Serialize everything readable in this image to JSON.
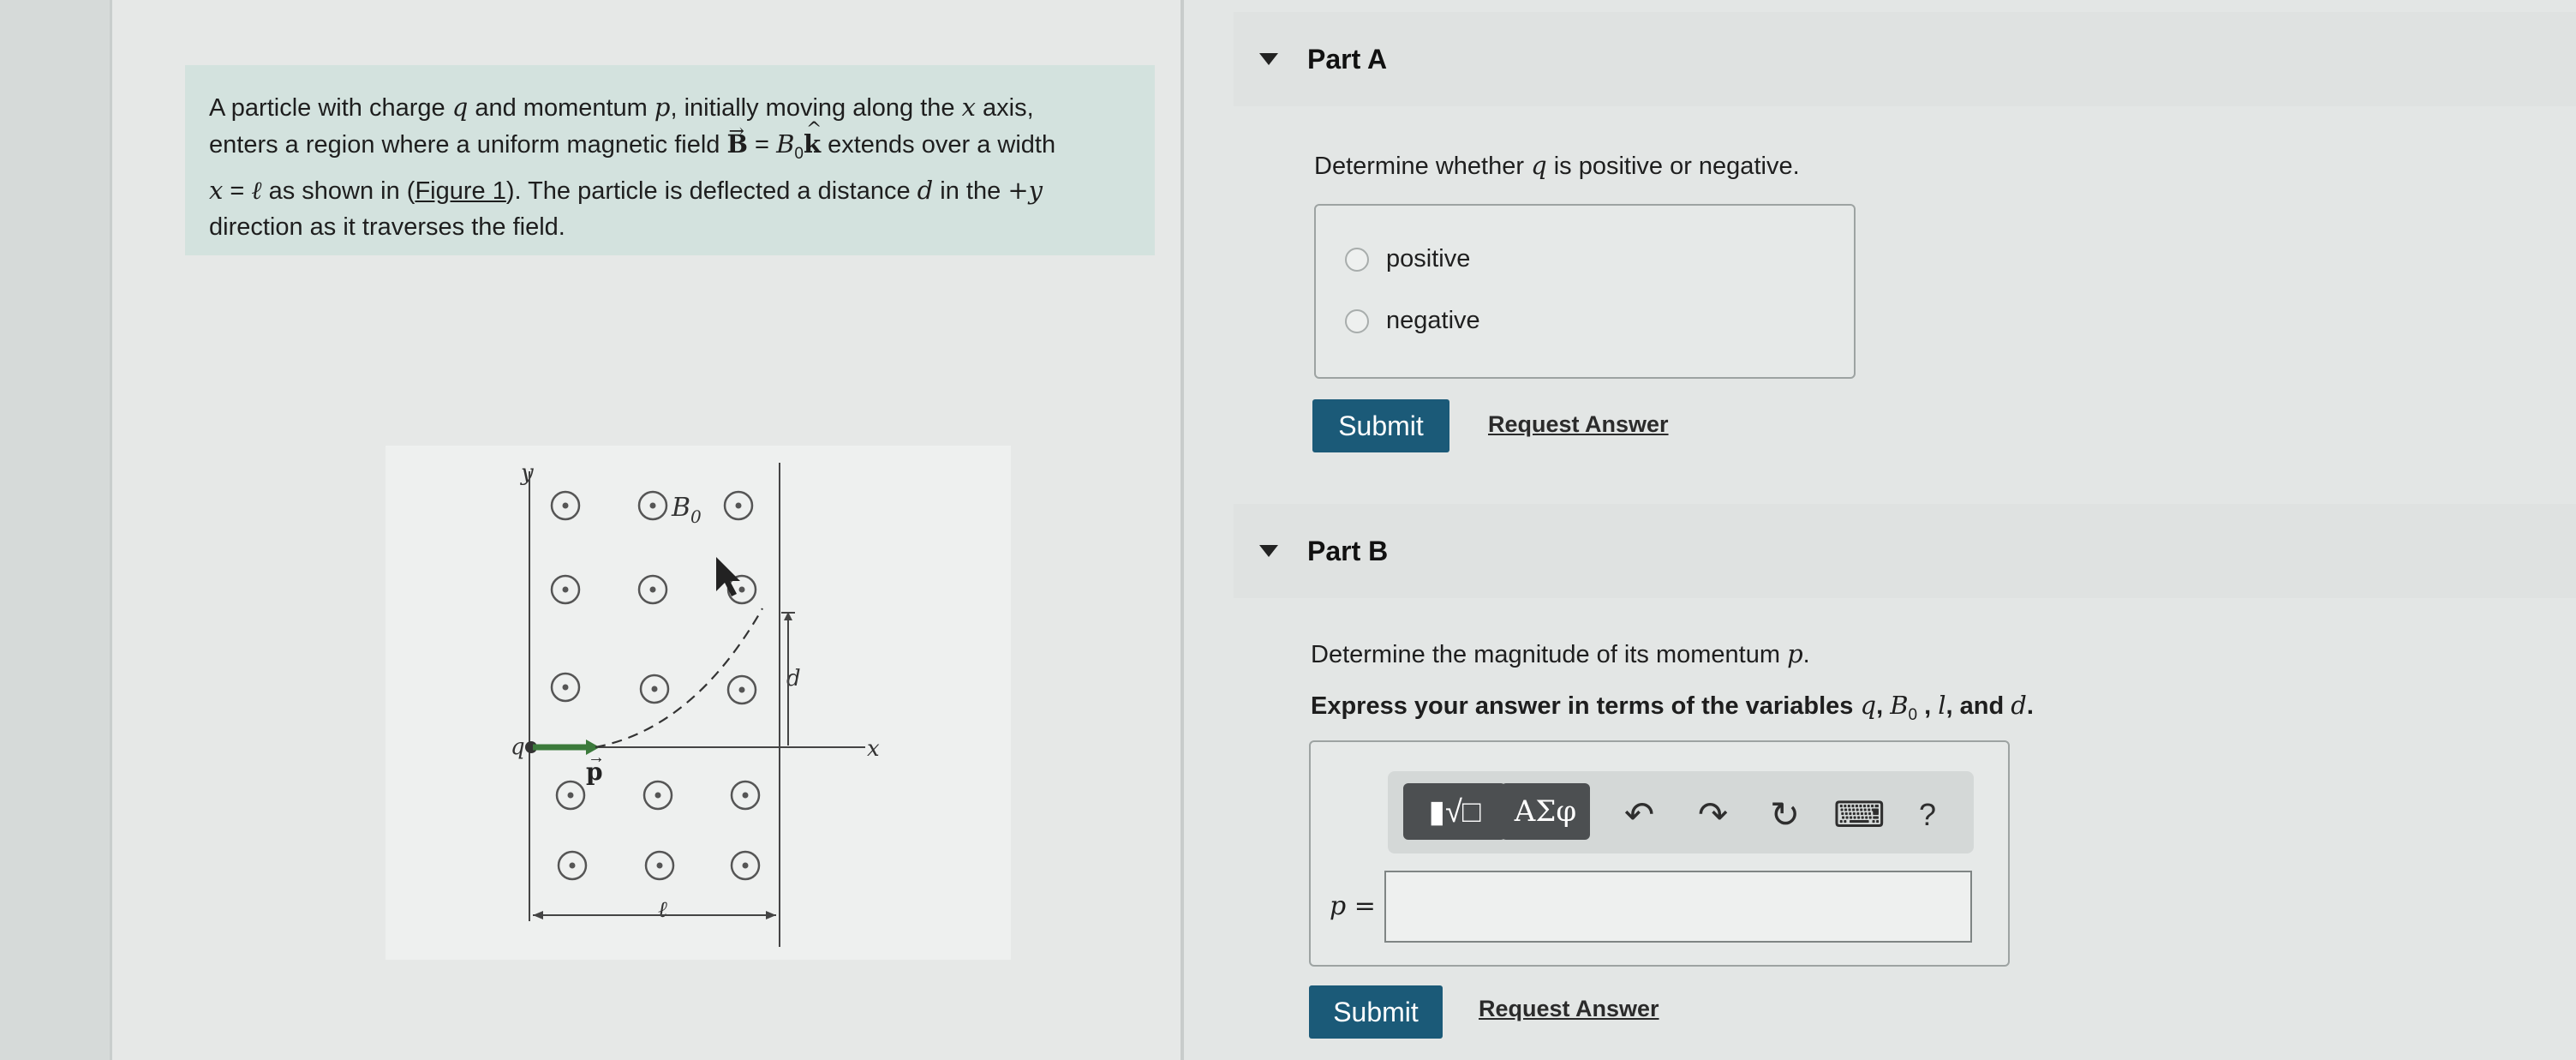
{
  "problem": {
    "line1_a": "A particle with charge ",
    "q": "q",
    "line1_b": " and momentum ",
    "p": "p",
    "line1_c": ", initially moving along the ",
    "x": "x",
    "line1_d": " axis,",
    "line2_a": "enters a region where a uniform magnetic field ",
    "Bvec": "B",
    "eq": " = ",
    "B0": "B",
    "sub0": "0",
    "khat": "k",
    "line2_b": " extends over a width",
    "xeq": "x",
    "eq2": " = ",
    "ell": "ℓ",
    "line3_a": " as shown in (",
    "figure_link": "Figure 1",
    "line3_b": "). The particle is deflected a distance ",
    "d": "d",
    "line3_c": " in the ",
    "plusy": "+y",
    "line4": "direction as it traverses the field."
  },
  "figure": {
    "y_axis": "y",
    "x_axis": "x",
    "charge": "q",
    "momentum": "p",
    "field": "B",
    "field_sub": "0",
    "deflection": "d",
    "width": "ℓ"
  },
  "partA": {
    "title": "Part A",
    "question_a": "Determine whether ",
    "q": "q",
    "question_b": " is positive or negative.",
    "options": [
      "positive",
      "negative"
    ],
    "submit": "Submit",
    "request": "Request Answer"
  },
  "partB": {
    "title": "Part B",
    "question_a": "Determine the magnitude of its momentum ",
    "p": "p",
    "question_b": ".",
    "instr_a": "Express your answer in terms of the variables ",
    "v_q": "q",
    "sep1": ", ",
    "v_B": "B",
    "v_B_sub": "0",
    "sep2": " , ",
    "v_l": "l",
    "sep3": ", and ",
    "v_d": "d",
    "instr_end": ".",
    "toolbar": {
      "template_glyph": "▮√□",
      "greek_glyph": "ΑΣφ",
      "undo_glyph": "↶",
      "redo_glyph": "↷",
      "reset_glyph": "↻",
      "keyboard_glyph": "⌨",
      "help_glyph": "?"
    },
    "answer_label": "p =",
    "submit": "Submit",
    "request": "Request Answer"
  },
  "colors": {
    "submit_bg": "#1b5a78",
    "problem_bg": "#d3e2de",
    "momentum_arrow": "#3b7a3b"
  }
}
